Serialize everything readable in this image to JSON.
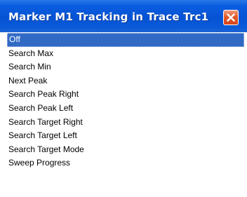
{
  "window": {
    "title": "Marker M1 Tracking in Trace Trc1",
    "close_icon": "close-icon"
  },
  "list": {
    "selected_index": 0,
    "items": [
      {
        "label": "Off"
      },
      {
        "label": "Search Max"
      },
      {
        "label": "Search Min"
      },
      {
        "label": "Next Peak"
      },
      {
        "label": "Search Peak Right"
      },
      {
        "label": "Search Peak Left"
      },
      {
        "label": "Search Target Right"
      },
      {
        "label": "Search Target Left"
      },
      {
        "label": "Search Target Mode"
      },
      {
        "label": "Sweep Progress"
      }
    ]
  },
  "colors": {
    "titlebar": "#0653d4",
    "selection": "#316ac5",
    "close_button": "#d6461a"
  }
}
